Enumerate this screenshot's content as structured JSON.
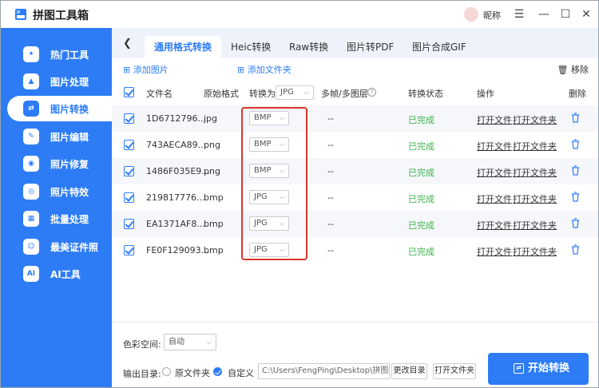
{
  "app": {
    "title": "拼图工具箱",
    "nickname": "昵称"
  },
  "window": {
    "menu": "☰",
    "minimize": "—",
    "maximize": "☐",
    "close": "✕"
  },
  "sidebar": {
    "items": [
      {
        "label": "热门工具",
        "glyph": "✦"
      },
      {
        "label": "图片处理",
        "glyph": "▲"
      },
      {
        "label": "图片转换",
        "glyph": "⇄"
      },
      {
        "label": "图片编辑",
        "glyph": "✎"
      },
      {
        "label": "照片修复",
        "glyph": "◉"
      },
      {
        "label": "照片特效",
        "glyph": "◎"
      },
      {
        "label": "批量处理",
        "glyph": "▦"
      },
      {
        "label": "最美证件照",
        "glyph": "☺"
      },
      {
        "label": "AI工具",
        "glyph": "AI"
      }
    ],
    "active_index": 2
  },
  "tabs": [
    "通用格式转换",
    "Heic转换",
    "Raw转换",
    "图片转PDF",
    "图片合成GIF"
  ],
  "toolbar": {
    "add_image": "添加图片",
    "add_folder": "添加文件夹",
    "remove": "移除"
  },
  "table": {
    "headers": {
      "filename": "文件名",
      "original_format": "原始格式",
      "convert_to": "转换为",
      "convert_to_value": "JPG",
      "frames": "多帧/多图层",
      "status": "转换状态",
      "actions": "操作",
      "delete": "删除"
    },
    "rows": [
      {
        "name": "1D6712796...",
        "format": "jpg",
        "target": "BMP",
        "frames": "--",
        "status": "已完成",
        "open_file": "打开文件",
        "open_folder": "打开文件夹"
      },
      {
        "name": "743AECA89...",
        "format": "png",
        "target": "BMP",
        "frames": "--",
        "status": "已完成",
        "open_file": "打开文件",
        "open_folder": "打开文件夹"
      },
      {
        "name": "1486F035E9...",
        "format": "png",
        "target": "BMP",
        "frames": "--",
        "status": "已完成",
        "open_file": "打开文件",
        "open_folder": "打开文件夹"
      },
      {
        "name": "219817776...",
        "format": "bmp",
        "target": "JPG",
        "frames": "--",
        "status": "已完成",
        "open_file": "打开文件",
        "open_folder": "打开文件夹"
      },
      {
        "name": "EA1371AF8...",
        "format": "bmp",
        "target": "JPG",
        "frames": "--",
        "status": "已完成",
        "open_file": "打开文件",
        "open_folder": "打开文件夹"
      },
      {
        "name": "FE0F129093...",
        "format": "bmp",
        "target": "JPG",
        "frames": "--",
        "status": "已完成",
        "open_file": "打开文件",
        "open_folder": "打开文件夹"
      }
    ]
  },
  "bottom": {
    "color_space_label": "色彩空间:",
    "color_space_value": "自动",
    "output_label": "输出目录:",
    "option_original": "原文件夹",
    "option_custom": "自定义",
    "path": "C:\\Users\\FengPing\\Desktop\\拼图...",
    "change_dir": "更改目录",
    "open_folder": "打开文件夹",
    "start": "开始转换"
  }
}
